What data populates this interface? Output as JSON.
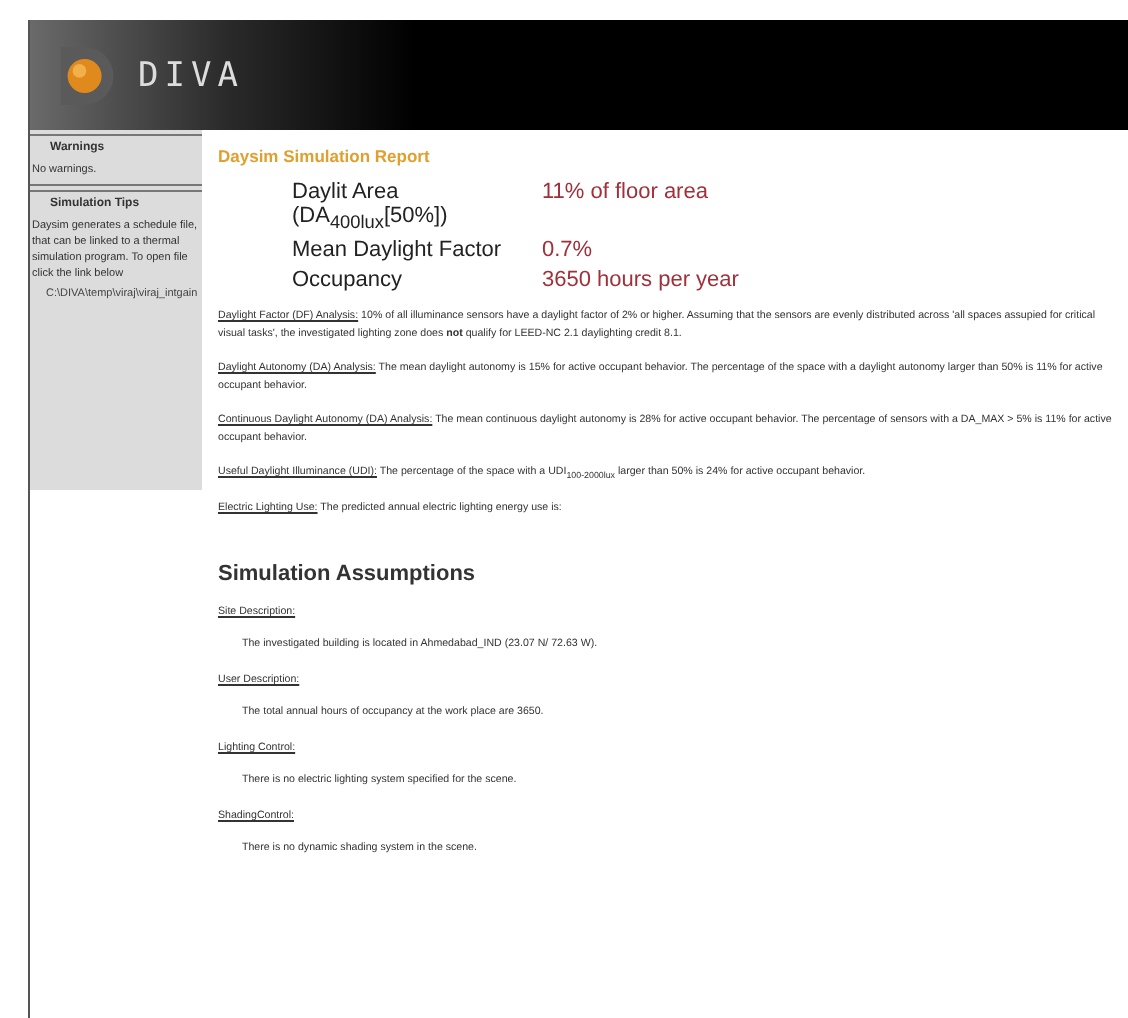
{
  "header": {
    "logo_text": "DIVA"
  },
  "sidebar": {
    "sections": [
      {
        "title": "Warnings",
        "text": "No warnings."
      },
      {
        "title": "Simulation Tips",
        "text": "Daysim generates a schedule file, that can be linked to a thermal simulation program. To open file click the link below",
        "link": "C:\\DIVA\\temp\\viraj\\viraj_intgain"
      }
    ]
  },
  "report": {
    "title": "Daysim Simulation Report",
    "metrics": [
      {
        "label": "Daylit Area (DA$_{400lux}$[50%])",
        "value": "11% of floor area"
      },
      {
        "label": "Mean Daylight Factor",
        "value": "0.7%"
      },
      {
        "label": "Occupancy",
        "value": "3650 hours per year"
      }
    ],
    "analyses": [
      {
        "heading": "Daylight Factor (DF) Analysis:",
        "text": "10% of all illuminance sensors have a daylight factor of 2% or higher. Assuming that the sensors are evenly distributed across 'all spaces assupied for critical visual tasks', the investigated lighting zone does **not** qualify for LEED-NC 2.1 daylighting credit 8.1."
      },
      {
        "heading": "Daylight Autonomy (DA) Analysis:",
        "text": "The mean daylight autonomy is 15% for active occupant behavior. The percentage of the space with a daylight autonomy larger than 50% is 11% for active occupant behavior."
      },
      {
        "heading": "Continuous Daylight Autonomy (DA) Analysis:",
        "text": "The mean continuous daylight autonomy is 28% for active occupant behavior. The percentage of sensors with a DA_MAX > 5% is 11% for active occupant behavior."
      },
      {
        "heading": "Useful Daylight Illuminance (UDI):",
        "text": "The percentage of the space with a UDI$_{100-2000lux}$ larger than 50% is 24% for active occupant behavior."
      },
      {
        "heading": "Electric Lighting Use:",
        "text": "The predicted annual electric lighting energy use is:"
      }
    ]
  },
  "assumptions": {
    "title": "Simulation Assumptions",
    "items": [
      {
        "heading": "Site Description:",
        "text": "The investigated building is located in Ahmedabad_IND (23.07 N/ 72.63 W)."
      },
      {
        "heading": "User Description:",
        "text": "The total annual hours of occupancy at the work place are 3650."
      },
      {
        "heading": "Lighting Control:",
        "text": "There is no electric lighting system specified for the scene."
      },
      {
        "heading": "ShadingControl:",
        "text": "There is no dynamic shading system in the scene."
      }
    ]
  }
}
